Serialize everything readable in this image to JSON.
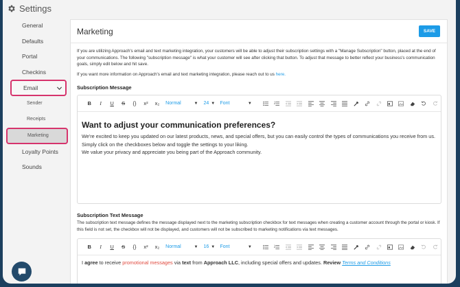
{
  "header": {
    "title": "Settings"
  },
  "sidebar": {
    "items": [
      {
        "label": "General",
        "type": "item"
      },
      {
        "label": "Defaults",
        "type": "item"
      },
      {
        "label": "Portal",
        "type": "item"
      },
      {
        "label": "Checkins",
        "type": "item"
      },
      {
        "label": "Email",
        "type": "email"
      },
      {
        "label": "Sender",
        "type": "sub"
      },
      {
        "label": "Receipts",
        "type": "sub"
      },
      {
        "label": "Marketing",
        "type": "marketing"
      },
      {
        "label": "Loyalty Points",
        "type": "item"
      },
      {
        "label": "Sounds",
        "type": "item"
      }
    ]
  },
  "main": {
    "title": "Marketing",
    "save_label": "SAVE",
    "intro": "If you are utilizing Approach's email and text marketing integration, your customers will be able to adjust their subscription settings with a \"Manage Subscription\" button, placed at the end of your communications. The following \"subscription message\" is what your customer will see after clicking that button. To adjust that message to better reflect your business's communication goals, simply edit below and hit save.",
    "more_info": "If you want more information on Approach's email and text marketing integration, please reach out to us ",
    "more_info_link": "here.",
    "subscription_message": {
      "title": "Subscription Message",
      "toolbar": {
        "style": "Normal",
        "size": "24",
        "font": "Font"
      },
      "heading": "Want to adjust your communication preferences?",
      "lines": [
        "We're excited to keep you updated on our latest products, news, and special offers, but you can easily control the types of communications you receive from us.",
        "Simply click on the checkboxes below and toggle the settings to your liking.",
        "We value your privacy and appreciate you being part of the Approach community."
      ]
    },
    "subscription_text": {
      "title": "Subscription Text Message",
      "description": "The subscription text message defines the message displayed next to the marketing subscription checkbox for text messages when creating a customer account through the portal or kiosk. If this field is not set, the checkbox will not be displayed, and customers will not be subscribed to marketing notifications via text messages.",
      "toolbar": {
        "style": "Normal",
        "size": "16",
        "font": "Font"
      },
      "agree_parts": {
        "p1": "I ",
        "bold1": "agree",
        "p2": " to receive ",
        "red": "promotional messages",
        "p3": " via ",
        "bold2": "text",
        "p4": " from ",
        "bold3": "Approach LLC",
        "p5": ", including special offers and updates. ",
        "bold4": "Review",
        "link": "Terms and Conditions"
      }
    }
  }
}
